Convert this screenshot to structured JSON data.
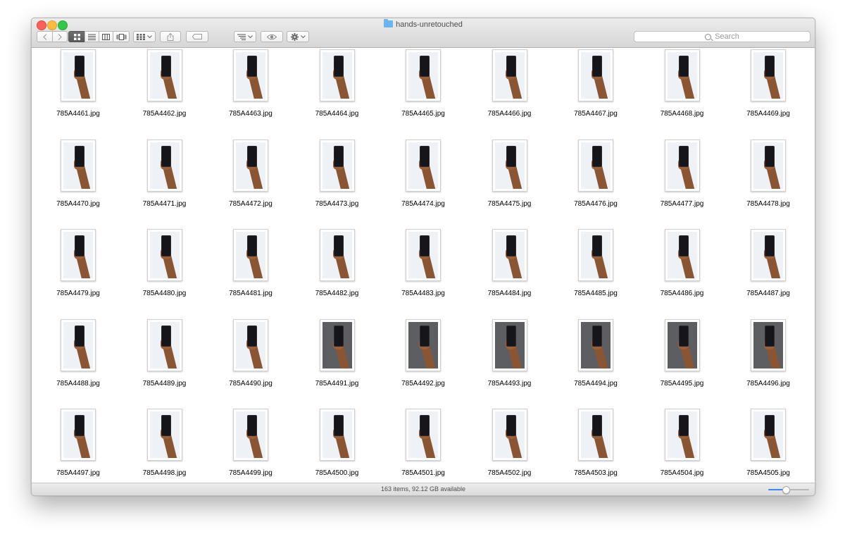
{
  "window": {
    "title": "hands-unretouched",
    "folder_icon": "folder-icon"
  },
  "toolbar": {
    "back_icon": "chevron-left-icon",
    "forward_icon": "chevron-right-icon",
    "view_modes": [
      {
        "name": "icon-view",
        "active": true
      },
      {
        "name": "list-view",
        "active": false
      },
      {
        "name": "column-view",
        "active": false
      },
      {
        "name": "cover-flow-view",
        "active": false
      }
    ],
    "arrange_icon": "arrange-grid-icon",
    "share_icon": "share-icon",
    "tag_icon": "tag-icon",
    "sort_icon": "sort-lines-icon",
    "quicklook_icon": "eye-icon",
    "action_icon": "gear-icon",
    "search_placeholder": "Search"
  },
  "files": [
    {
      "name": "785A4461.jpg",
      "bg": "light"
    },
    {
      "name": "785A4462.jpg",
      "bg": "light"
    },
    {
      "name": "785A4463.jpg",
      "bg": "light"
    },
    {
      "name": "785A4464.jpg",
      "bg": "light"
    },
    {
      "name": "785A4465.jpg",
      "bg": "light"
    },
    {
      "name": "785A4466.jpg",
      "bg": "light"
    },
    {
      "name": "785A4467.jpg",
      "bg": "light"
    },
    {
      "name": "785A4468.jpg",
      "bg": "light"
    },
    {
      "name": "785A4469.jpg",
      "bg": "light"
    },
    {
      "name": "785A4470.jpg",
      "bg": "light"
    },
    {
      "name": "785A4471.jpg",
      "bg": "light"
    },
    {
      "name": "785A4472.jpg",
      "bg": "light"
    },
    {
      "name": "785A4473.jpg",
      "bg": "light"
    },
    {
      "name": "785A4474.jpg",
      "bg": "light"
    },
    {
      "name": "785A4475.jpg",
      "bg": "light"
    },
    {
      "name": "785A4476.jpg",
      "bg": "light"
    },
    {
      "name": "785A4477.jpg",
      "bg": "light"
    },
    {
      "name": "785A4478.jpg",
      "bg": "light"
    },
    {
      "name": "785A4479.jpg",
      "bg": "light"
    },
    {
      "name": "785A4480.jpg",
      "bg": "light"
    },
    {
      "name": "785A4481.jpg",
      "bg": "light"
    },
    {
      "name": "785A4482.jpg",
      "bg": "light"
    },
    {
      "name": "785A4483.jpg",
      "bg": "light"
    },
    {
      "name": "785A4484.jpg",
      "bg": "light"
    },
    {
      "name": "785A4485.jpg",
      "bg": "light"
    },
    {
      "name": "785A4486.jpg",
      "bg": "light"
    },
    {
      "name": "785A4487.jpg",
      "bg": "light"
    },
    {
      "name": "785A4488.jpg",
      "bg": "light"
    },
    {
      "name": "785A4489.jpg",
      "bg": "light"
    },
    {
      "name": "785A4490.jpg",
      "bg": "light"
    },
    {
      "name": "785A4491.jpg",
      "bg": "dark"
    },
    {
      "name": "785A4492.jpg",
      "bg": "dark"
    },
    {
      "name": "785A4493.jpg",
      "bg": "dark"
    },
    {
      "name": "785A4494.jpg",
      "bg": "dark"
    },
    {
      "name": "785A4495.jpg",
      "bg": "dark"
    },
    {
      "name": "785A4496.jpg",
      "bg": "dark"
    },
    {
      "name": "785A4497.jpg",
      "bg": "light"
    },
    {
      "name": "785A4498.jpg",
      "bg": "light"
    },
    {
      "name": "785A4499.jpg",
      "bg": "light"
    },
    {
      "name": "785A4500.jpg",
      "bg": "light"
    },
    {
      "name": "785A4501.jpg",
      "bg": "light"
    },
    {
      "name": "785A4502.jpg",
      "bg": "light"
    },
    {
      "name": "785A4503.jpg",
      "bg": "light"
    },
    {
      "name": "785A4504.jpg",
      "bg": "light"
    },
    {
      "name": "785A4505.jpg",
      "bg": "light"
    }
  ],
  "status": {
    "text": "163 items, 92.12 GB available",
    "icon_size_level": 0.42
  },
  "colors": {
    "accent": "#3b87f0",
    "close": "#fc605b",
    "minimize": "#fdbc40",
    "zoom": "#34c84a"
  }
}
